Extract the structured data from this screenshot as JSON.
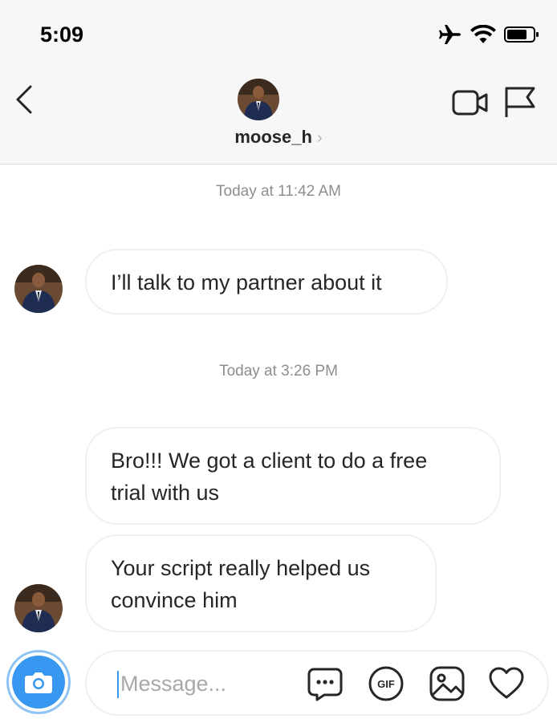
{
  "status_bar": {
    "time": "5:09"
  },
  "header": {
    "username": "moose_h",
    "chevron": "›"
  },
  "messages": [
    {
      "timestamp": "Today at 11:42 AM"
    },
    {
      "text": "I’ll talk to my partner about it"
    },
    {
      "timestamp": "Today at 3:26 PM"
    },
    {
      "lines": [
        "Bro!!! We got a client to do a free",
        "trial with us"
      ]
    },
    {
      "lines": [
        "Your script really helped us",
        "convince him"
      ]
    }
  ],
  "composer": {
    "placeholder": "Message...",
    "gif_label": "GIF"
  },
  "icons": [
    "airplane-icon",
    "wifi-icon",
    "battery-icon",
    "back-icon",
    "video-call-icon",
    "flag-icon",
    "camera-icon",
    "chat-bubble-icon",
    "gif-icon",
    "image-icon",
    "heart-icon"
  ],
  "colors": {
    "accent": "#3897f0",
    "bubble_border": "#efefef",
    "muted": "#8e8e8e",
    "header_bg": "#f7f7f7"
  }
}
